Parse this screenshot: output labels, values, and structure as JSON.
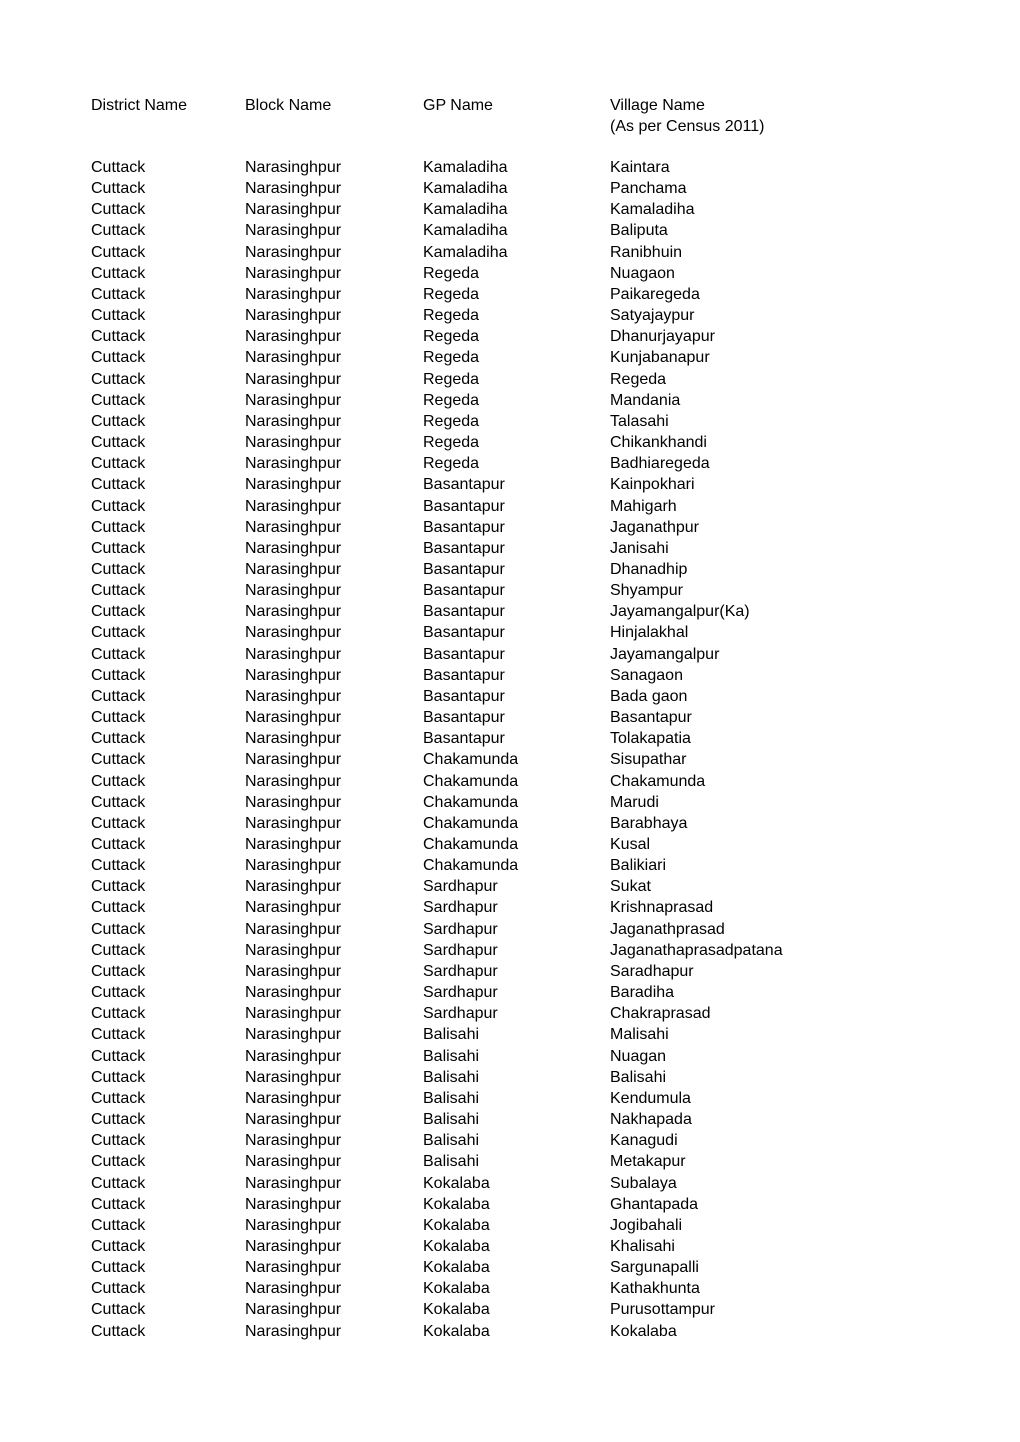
{
  "headers": {
    "district": "District Name",
    "block": "Block Name",
    "gp": "GP Name",
    "village_line1": "Village Name",
    "village_line2": "(As per Census 2011)"
  },
  "rows": [
    [
      "Cuttack",
      "Narasinghpur",
      "Kamaladiha",
      "Kaintara"
    ],
    [
      "Cuttack",
      "Narasinghpur",
      "Kamaladiha",
      "Panchama"
    ],
    [
      "Cuttack",
      "Narasinghpur",
      "Kamaladiha",
      "Kamaladiha"
    ],
    [
      "Cuttack",
      "Narasinghpur",
      "Kamaladiha",
      "Baliputa"
    ],
    [
      "Cuttack",
      "Narasinghpur",
      "Kamaladiha",
      "Ranibhuin"
    ],
    [
      "Cuttack",
      "Narasinghpur",
      "Regeda",
      "Nuagaon"
    ],
    [
      "Cuttack",
      "Narasinghpur",
      "Regeda",
      "Paikaregeda"
    ],
    [
      "Cuttack",
      "Narasinghpur",
      "Regeda",
      "Satyajaypur"
    ],
    [
      "Cuttack",
      "Narasinghpur",
      "Regeda",
      "Dhanurjayapur"
    ],
    [
      "Cuttack",
      "Narasinghpur",
      "Regeda",
      "Kunjabanapur"
    ],
    [
      "Cuttack",
      "Narasinghpur",
      "Regeda",
      "Regeda"
    ],
    [
      "Cuttack",
      "Narasinghpur",
      "Regeda",
      "Mandania"
    ],
    [
      "Cuttack",
      "Narasinghpur",
      "Regeda",
      "Talasahi"
    ],
    [
      "Cuttack",
      "Narasinghpur",
      "Regeda",
      "Chikankhandi"
    ],
    [
      "Cuttack",
      "Narasinghpur",
      "Regeda",
      "Badhiaregeda"
    ],
    [
      "Cuttack",
      "Narasinghpur",
      "Basantapur",
      "Kainpokhari"
    ],
    [
      "Cuttack",
      "Narasinghpur",
      "Basantapur",
      "Mahigarh"
    ],
    [
      "Cuttack",
      "Narasinghpur",
      "Basantapur",
      "Jaganathpur"
    ],
    [
      "Cuttack",
      "Narasinghpur",
      "Basantapur",
      "Janisahi"
    ],
    [
      "Cuttack",
      "Narasinghpur",
      "Basantapur",
      "Dhanadhip"
    ],
    [
      "Cuttack",
      "Narasinghpur",
      "Basantapur",
      "Shyampur"
    ],
    [
      "Cuttack",
      "Narasinghpur",
      "Basantapur",
      "Jayamangalpur(Ka)"
    ],
    [
      "Cuttack",
      "Narasinghpur",
      "Basantapur",
      "Hinjalakhal"
    ],
    [
      "Cuttack",
      "Narasinghpur",
      "Basantapur",
      "Jayamangalpur"
    ],
    [
      "Cuttack",
      "Narasinghpur",
      "Basantapur",
      "Sanagaon"
    ],
    [
      "Cuttack",
      "Narasinghpur",
      "Basantapur",
      "Bada gaon"
    ],
    [
      "Cuttack",
      "Narasinghpur",
      "Basantapur",
      "Basantapur"
    ],
    [
      "Cuttack",
      "Narasinghpur",
      "Basantapur",
      "Tolakapatia"
    ],
    [
      "Cuttack",
      "Narasinghpur",
      "Chakamunda",
      "Sisupathar"
    ],
    [
      "Cuttack",
      "Narasinghpur",
      "Chakamunda",
      "Chakamunda"
    ],
    [
      "Cuttack",
      "Narasinghpur",
      "Chakamunda",
      "Marudi"
    ],
    [
      "Cuttack",
      "Narasinghpur",
      "Chakamunda",
      "Barabhaya"
    ],
    [
      "Cuttack",
      "Narasinghpur",
      "Chakamunda",
      "Kusal"
    ],
    [
      "Cuttack",
      "Narasinghpur",
      "Chakamunda",
      "Balikiari"
    ],
    [
      "Cuttack",
      "Narasinghpur",
      "Sardhapur",
      "Sukat"
    ],
    [
      "Cuttack",
      "Narasinghpur",
      "Sardhapur",
      "Krishnaprasad"
    ],
    [
      "Cuttack",
      "Narasinghpur",
      "Sardhapur",
      "Jaganathprasad"
    ],
    [
      "Cuttack",
      "Narasinghpur",
      "Sardhapur",
      "Jaganathaprasadpatana"
    ],
    [
      "Cuttack",
      "Narasinghpur",
      "Sardhapur",
      "Saradhapur"
    ],
    [
      "Cuttack",
      "Narasinghpur",
      "Sardhapur",
      "Baradiha"
    ],
    [
      "Cuttack",
      "Narasinghpur",
      "Sardhapur",
      "Chakraprasad"
    ],
    [
      "Cuttack",
      "Narasinghpur",
      "Balisahi",
      "Malisahi"
    ],
    [
      "Cuttack",
      "Narasinghpur",
      "Balisahi",
      "Nuagan"
    ],
    [
      "Cuttack",
      "Narasinghpur",
      "Balisahi",
      "Balisahi"
    ],
    [
      "Cuttack",
      "Narasinghpur",
      "Balisahi",
      "Kendumula"
    ],
    [
      "Cuttack",
      "Narasinghpur",
      "Balisahi",
      "Nakhapada"
    ],
    [
      "Cuttack",
      "Narasinghpur",
      "Balisahi",
      "Kanagudi"
    ],
    [
      "Cuttack",
      "Narasinghpur",
      "Balisahi",
      "Metakapur"
    ],
    [
      "Cuttack",
      "Narasinghpur",
      "Kokalaba",
      "Subalaya"
    ],
    [
      "Cuttack",
      "Narasinghpur",
      "Kokalaba",
      "Ghantapada"
    ],
    [
      "Cuttack",
      "Narasinghpur",
      "Kokalaba",
      "Jogibahali"
    ],
    [
      "Cuttack",
      "Narasinghpur",
      "Kokalaba",
      "Khalisahi"
    ],
    [
      "Cuttack",
      "Narasinghpur",
      "Kokalaba",
      "Sargunapalli"
    ],
    [
      "Cuttack",
      "Narasinghpur",
      "Kokalaba",
      "Kathakhunta"
    ],
    [
      "Cuttack",
      "Narasinghpur",
      "Kokalaba",
      "Purusottampur"
    ],
    [
      "Cuttack",
      "Narasinghpur",
      "Kokalaba",
      "Kokalaba"
    ]
  ]
}
